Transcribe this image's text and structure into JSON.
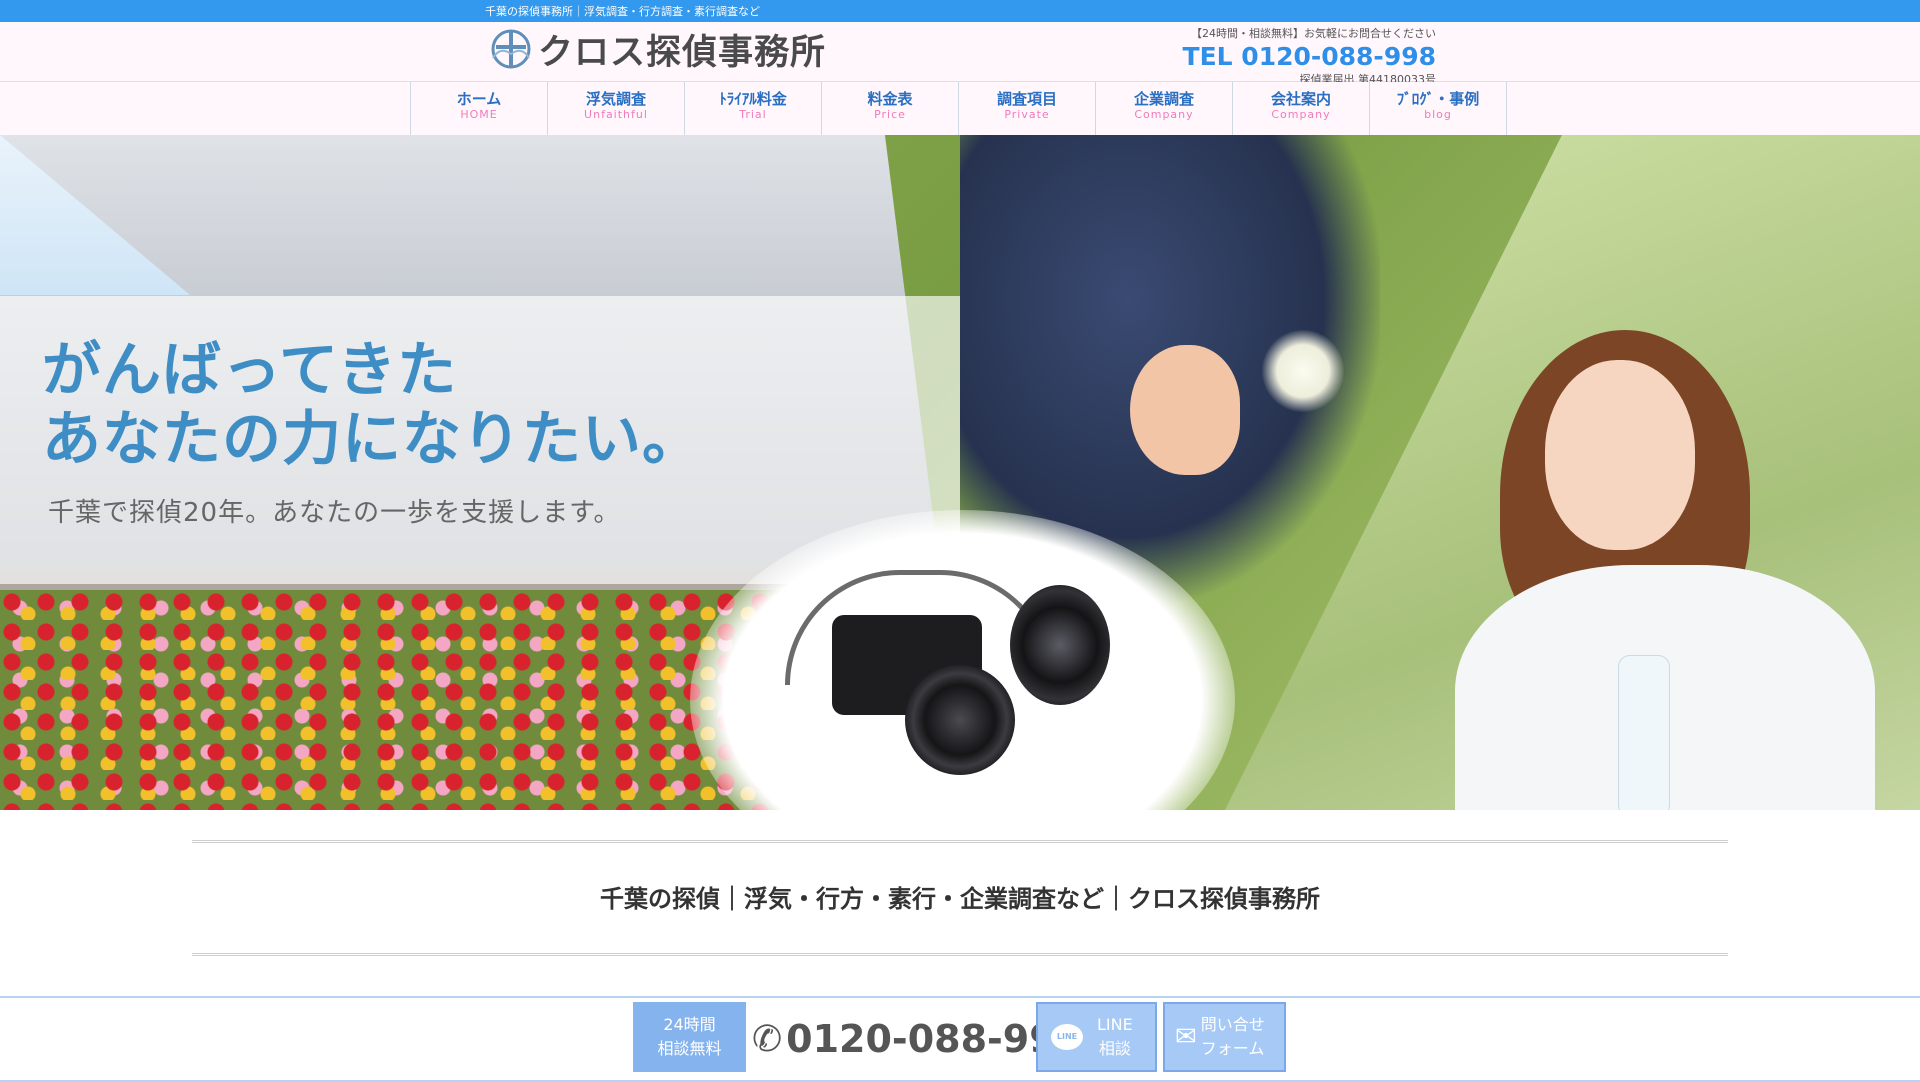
{
  "topbar": {
    "text": "千葉の探偵事務所｜浮気調査・行方調査・素行調査など"
  },
  "header": {
    "logo_text": "クロス探偵事務所",
    "contact_note": "【24時間・相談無料】お気軽にお問合せください",
    "tel": "TEL 0120-088-998",
    "registration": "探偵業届出 第44180033号"
  },
  "nav": {
    "items": [
      {
        "ja": "ホーム",
        "en": "HOME"
      },
      {
        "ja": "浮気調査",
        "en": "Unfaithful"
      },
      {
        "ja": "ﾄﾗｲｱﾙ料金",
        "en": "Trial"
      },
      {
        "ja": "料金表",
        "en": "Price"
      },
      {
        "ja": "調査項目",
        "en": "Private"
      },
      {
        "ja": "企業調査",
        "en": "Company"
      },
      {
        "ja": "会社案内",
        "en": "Company"
      },
      {
        "ja": "ﾌﾞﾛｸﾞ・事例",
        "en": "blog"
      }
    ]
  },
  "hero": {
    "headline_line1": "がんばってきた",
    "headline_line2": "あなたの力になりたい。",
    "subline": "千葉で探偵20年。あなたの一歩を支援します。"
  },
  "page_title": "千葉の探偵｜浮気・行方・素行・企業調査など｜クロス探偵事務所",
  "cta": {
    "free_line1": "24時間",
    "free_line2": "相談無料",
    "phone": "0120-088-998",
    "line_bubble": "LINE",
    "line_line1": "LINE",
    "line_line2": "相談",
    "form_line1": "問い合せ",
    "form_line2": "フォーム"
  },
  "colors": {
    "topbar": "#3399ee",
    "tel": "#2f8fe8",
    "nav_ja": "#2a6fc2",
    "nav_en": "#f07bbb",
    "headline": "#3e8ec5",
    "cta_button": "#a6c9f5"
  },
  "icons": {
    "phone": "phone-icon",
    "line": "line-chat-icon",
    "mail": "mail-icon",
    "logo": "cross-emblem-logo"
  }
}
